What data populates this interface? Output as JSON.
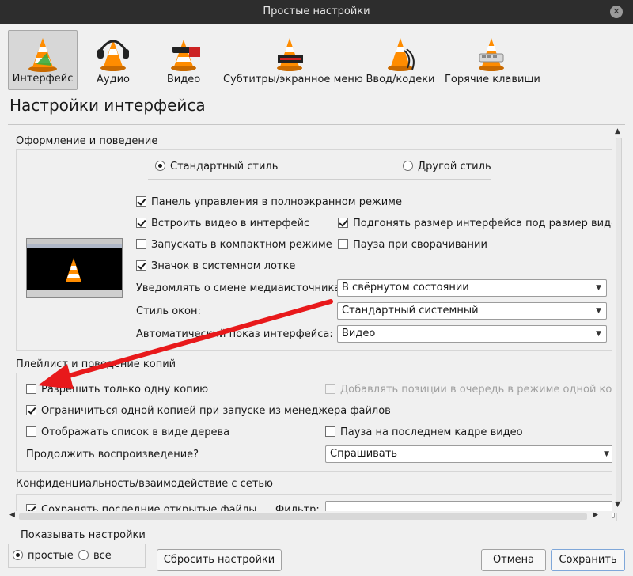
{
  "window": {
    "title": "Простые настройки"
  },
  "toolbar": {
    "items": [
      {
        "label": "Интерфейс",
        "icon": "vlc-cone-icon"
      },
      {
        "label": "Аудио",
        "icon": "headphones-icon"
      },
      {
        "label": "Видео",
        "icon": "video-glasses-icon"
      },
      {
        "label": "Субтитры/экранное меню",
        "icon": "subtitles-icon"
      },
      {
        "label": "Ввод/кодеки",
        "icon": "input-codecs-icon"
      },
      {
        "label": "Горячие клавиши",
        "icon": "hotkeys-icon"
      }
    ]
  },
  "page": {
    "title": "Настройки интерфейса"
  },
  "look": {
    "title": "Оформление и поведение",
    "style_native": "Стандартный стиль",
    "style_other": "Другой стиль",
    "fs_controller": "Панель управления в полноэкранном режиме",
    "embed_video": "Встроить видео в интерфейс",
    "resize_to_video": "Подгонять размер интерфейса под размер видео",
    "minimal_mode": "Запускать в компактном режиме",
    "pause_minimized": "Пауза при сворачивании",
    "systray": "Значок в системном лотке",
    "notify_label": "Уведомлять о смене медиаисточника:",
    "notify_value": "В свёрнутом состоянии",
    "style_label": "Стиль окон:",
    "style_value": "Стандартный системный",
    "autoraise_label": "Автоматический показ интерфейса:",
    "autoraise_value": "Видео"
  },
  "playlist": {
    "title": "Плейлист и поведение копий",
    "one_instance": "Разрешить только одну копию",
    "enqueue": "Добавлять позиции в очередь в режиме одной копии",
    "one_instance_fm": "Ограничиться одной копией при запуске из менеджера файлов",
    "tree_view": "Отображать список в виде дерева",
    "pause_last_frame": "Пауза на последнем кадре видео",
    "resume_label": "Продолжить воспроизведение?",
    "resume_value": "Спрашивать"
  },
  "privacy": {
    "title": "Конфиденциальность/взаимодействие с сетью",
    "save_recent": "Сохранять последние открытые файлы",
    "filter_label": "Фильтр:"
  },
  "footer": {
    "show_settings": "Показывать настройки",
    "simple": "простые",
    "all": "все",
    "reset": "Сбросить настройки",
    "cancel": "Отмена",
    "save": "Сохранить"
  },
  "colors": {
    "arrow": "#e8191b",
    "title_bar": "#2d2d2d"
  }
}
